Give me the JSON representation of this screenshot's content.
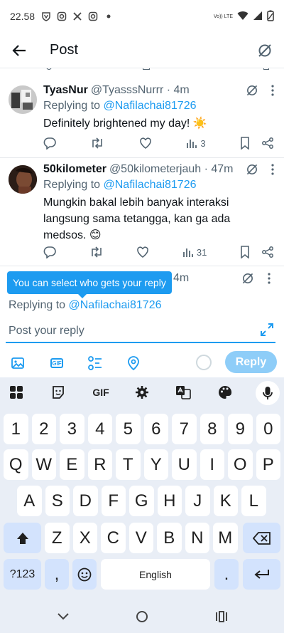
{
  "status_bar": {
    "time": "22.58",
    "network_label": "Vo)) LTE"
  },
  "header": {
    "title": "Post"
  },
  "tweets": [
    {
      "name": "TyasNur",
      "handle": "@TyasssNurrr",
      "time": "4m",
      "replying_prefix": "Replying to",
      "replying_to": "@Nafilachai81726",
      "text": "Definitely brightened my day! ☀️",
      "views": "3"
    },
    {
      "name": "50kilometer",
      "handle": "@50kilometerjauh",
      "time": "47m",
      "replying_prefix": "Replying to",
      "replying_to": "@Nafilachai81726",
      "text": "Mungkin bakal lebih banyak interaksi langsung sama tetangga, kan ga ada medsos. 😊",
      "views": "31"
    }
  ],
  "partial_time": "4m",
  "tooltip": "You can select who gets your reply",
  "compose": {
    "replying_prefix": "Replying to",
    "replying_to": "@Nafilachai81726",
    "placeholder": "Post your reply",
    "reply_button": "Reply",
    "gif_label": "GIF"
  },
  "keyboard": {
    "toolbar_gif": "GIF",
    "number_row": [
      "1",
      "2",
      "3",
      "4",
      "5",
      "6",
      "7",
      "8",
      "9",
      "0"
    ],
    "row1": [
      "Q",
      "W",
      "E",
      "R",
      "T",
      "Y",
      "U",
      "I",
      "O",
      "P"
    ],
    "row2": [
      "A",
      "S",
      "D",
      "F",
      "G",
      "H",
      "J",
      "K",
      "L"
    ],
    "row3": [
      "Z",
      "X",
      "C",
      "V",
      "B",
      "N",
      "M"
    ],
    "symbols_key": "?123",
    "comma_key": ",",
    "space_key": "English",
    "period_key": "."
  },
  "colors": {
    "accent": "#1d9bf0",
    "reply_button_disabled": "#8ecdf8",
    "keyboard_bg": "#e9eef6",
    "function_key": "#d3e3fd"
  }
}
